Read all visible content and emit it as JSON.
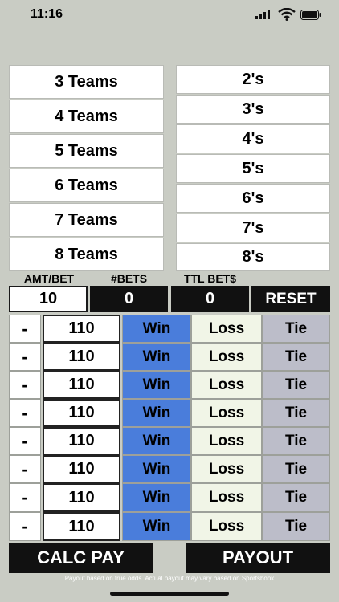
{
  "status": {
    "time": "11:16"
  },
  "teams": [
    "3 Teams",
    "4 Teams",
    "5 Teams",
    "6 Teams",
    "7 Teams",
    "8 Teams"
  ],
  "splits": [
    "2's",
    "3's",
    "4's",
    "5's",
    "6's",
    "7's",
    "8's"
  ],
  "labels": {
    "amt_bet": "AMT/BET",
    "num_bets": "#BETS",
    "ttl_bets": "TTL BET$"
  },
  "values": {
    "amt_bet": "10",
    "num_bets": "0",
    "ttl_bets": "0"
  },
  "reset_label": "RESET",
  "rows": [
    {
      "minus": "-",
      "odds": "110",
      "win": "Win",
      "loss": "Loss",
      "tie": "Tie"
    },
    {
      "minus": "-",
      "odds": "110",
      "win": "Win",
      "loss": "Loss",
      "tie": "Tie"
    },
    {
      "minus": "-",
      "odds": "110",
      "win": "Win",
      "loss": "Loss",
      "tie": "Tie"
    },
    {
      "minus": "-",
      "odds": "110",
      "win": "Win",
      "loss": "Loss",
      "tie": "Tie"
    },
    {
      "minus": "-",
      "odds": "110",
      "win": "Win",
      "loss": "Loss",
      "tie": "Tie"
    },
    {
      "minus": "-",
      "odds": "110",
      "win": "Win",
      "loss": "Loss",
      "tie": "Tie"
    },
    {
      "minus": "-",
      "odds": "110",
      "win": "Win",
      "loss": "Loss",
      "tie": "Tie"
    },
    {
      "minus": "-",
      "odds": "110",
      "win": "Win",
      "loss": "Loss",
      "tie": "Tie"
    }
  ],
  "calc_pay_label": "CALC PAY",
  "payout_label": "PAYOUT",
  "disclaimer": "Payout based on true odds. Actual payout may vary based on Sportsbook",
  "colors": {
    "win": "#4a7ddb",
    "loss": "#f1f5e7",
    "tie": "#bcbdc9",
    "background": "#c9ccc4"
  }
}
